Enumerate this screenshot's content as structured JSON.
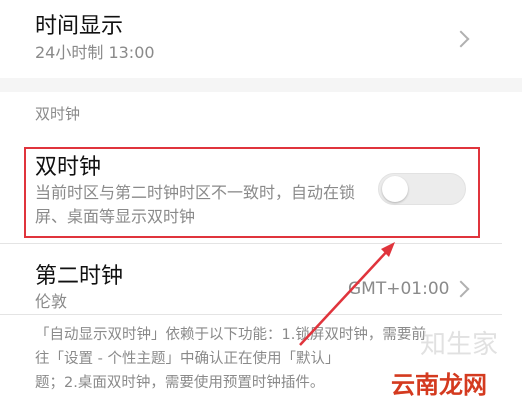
{
  "time_display": {
    "title": "时间显示",
    "subtitle": "24小时制 13:00"
  },
  "section_header": "双时钟",
  "dual_clock": {
    "title": "双时钟",
    "description_line1": "当前时区与第二时钟时区不一致时，自动在锁",
    "description_line2": "屏、桌面等显示双时钟",
    "enabled": false
  },
  "second_clock": {
    "title": "第二时钟",
    "subtitle": "伦敦",
    "value": "GMT+01:00"
  },
  "footnote": {
    "line1": "「自动显示双时钟」依赖于以下功能：1.锁屏双时钟，需要前",
    "line2": "往「设置 - 个性主题」中确认正在使用「默认」",
    "line3": "题；2.桌面双时钟，需要使用预置时钟插件。"
  },
  "watermark": {
    "text": "云南龙网",
    "faint_text": "知生家"
  },
  "colors": {
    "highlight": "#e0343c",
    "primary_text": "#111111",
    "secondary_text": "#8a8a8a"
  },
  "icons": {
    "chevron": "chevron-right-icon",
    "toggle": "toggle-switch"
  }
}
